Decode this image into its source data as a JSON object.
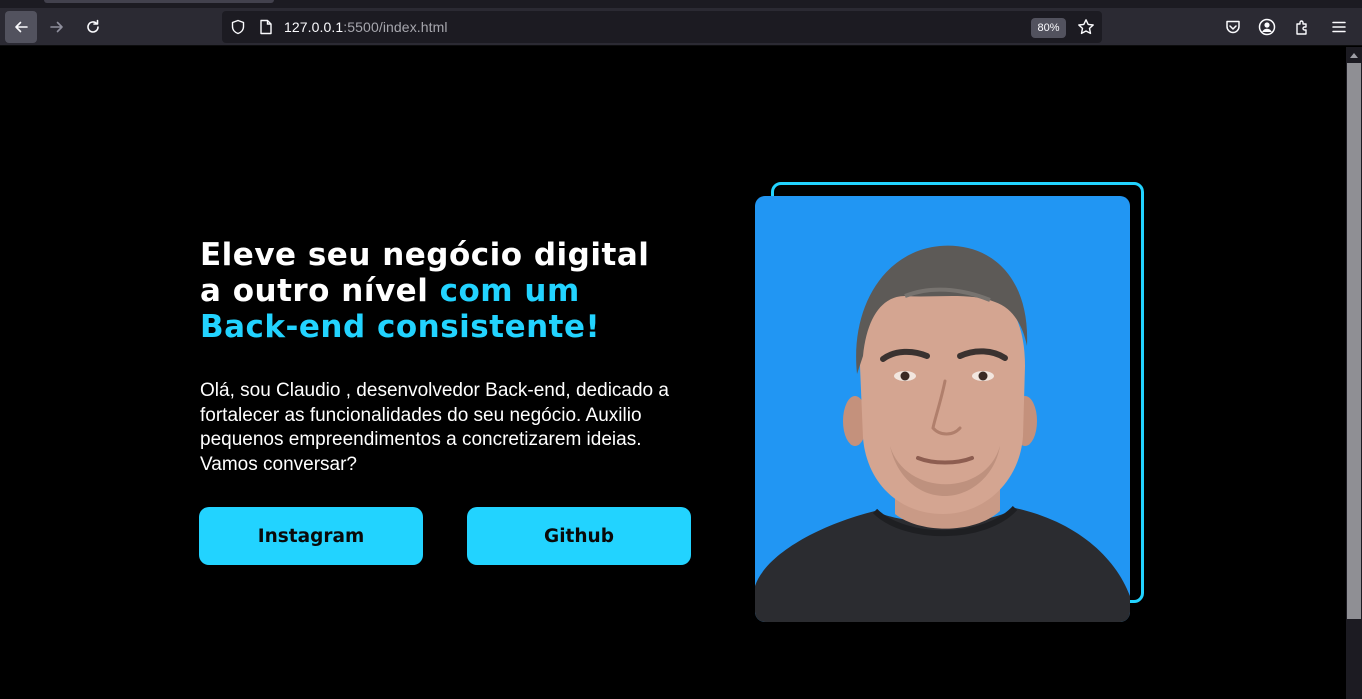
{
  "browser": {
    "url_host": "127.0.0.1",
    "url_rest": ":5500/index.html",
    "zoom": "80%",
    "icons": {
      "back": "back-arrow-icon",
      "forward": "forward-arrow-icon",
      "reload": "reload-icon",
      "shield": "shield-icon",
      "page": "page-icon",
      "bookmark": "star-icon",
      "pocket": "pocket-icon",
      "account": "account-icon",
      "extensions": "extensions-icon",
      "menu": "hamburger-menu-icon"
    }
  },
  "hero": {
    "title_line1": "Eleve seu negócio digital",
    "title_line2a": "a outro nível ",
    "title_line2b": "com um",
    "title_line3": "Back-end consistente!",
    "description": "Olá, sou Claudio , desenvolvedor Back-end, dedicado a fortalecer as funcionalidades do seu negócio. Auxilio pequenos empreendimentos a concretizarem ideias. Vamos conversar?",
    "buttons": {
      "instagram": "Instagram",
      "github": "Github"
    }
  },
  "colors": {
    "accent": "#22d3ff",
    "photo_background": "#2196f3",
    "page_background": "#000000"
  }
}
